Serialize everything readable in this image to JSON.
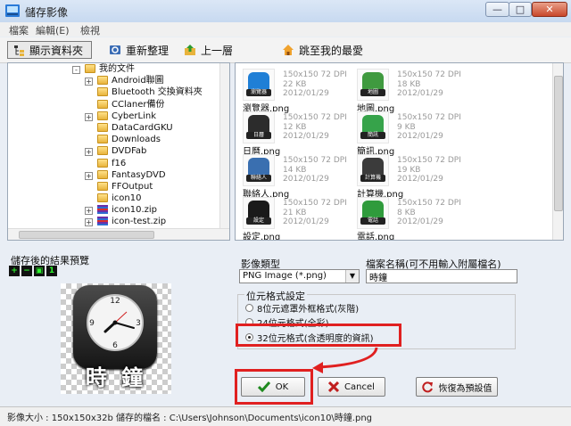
{
  "window": {
    "title": "儲存影像"
  },
  "menu": [
    "檔案",
    "編輯(E)",
    "檢視"
  ],
  "toolbar": {
    "show_folders": "顯示資料夾",
    "refresh": "重新整理",
    "up": "上一層",
    "favorites": "跳至我的最愛"
  },
  "tree": [
    {
      "label": "我的文件",
      "indent": 0,
      "expander": "-",
      "icon": "folder"
    },
    {
      "label": "Android聯圖",
      "indent": 1,
      "expander": "+",
      "icon": "folder"
    },
    {
      "label": "Bluetooth 交換資料夾",
      "indent": 1,
      "expander": "",
      "icon": "folder"
    },
    {
      "label": "CClaner備份",
      "indent": 1,
      "expander": "",
      "icon": "folder"
    },
    {
      "label": "CyberLink",
      "indent": 1,
      "expander": "+",
      "icon": "folder"
    },
    {
      "label": "DataCardGKU",
      "indent": 1,
      "expander": "",
      "icon": "folder"
    },
    {
      "label": "Downloads",
      "indent": 1,
      "expander": "",
      "icon": "folder"
    },
    {
      "label": "DVDFab",
      "indent": 1,
      "expander": "+",
      "icon": "folder"
    },
    {
      "label": "f16",
      "indent": 1,
      "expander": "",
      "icon": "folder"
    },
    {
      "label": "FantasyDVD",
      "indent": 1,
      "expander": "+",
      "icon": "folder"
    },
    {
      "label": "FFOutput",
      "indent": 1,
      "expander": "",
      "icon": "folder"
    },
    {
      "label": "icon10",
      "indent": 1,
      "expander": "",
      "icon": "folder"
    },
    {
      "label": "icon10.zip",
      "indent": 1,
      "expander": "+",
      "icon": "zip"
    },
    {
      "label": "icon-test.zip",
      "indent": 1,
      "expander": "+",
      "icon": "zip"
    }
  ],
  "files": [
    {
      "name": "瀏覽器.png",
      "dims": "150x150 72 DPI",
      "size": "22 KB",
      "date": "2012/01/29",
      "icon": "browser-icon",
      "color": "#1f7fd6",
      "caption": "瀏覽器"
    },
    {
      "name": "地圖.png",
      "dims": "150x150 72 DPI",
      "size": "18 KB",
      "date": "2012/01/29",
      "icon": "map-icon",
      "color": "#3f9a3f",
      "caption": "地圖"
    },
    {
      "name": "日曆.png",
      "dims": "150x150 72 DPI",
      "size": "12 KB",
      "date": "2012/01/29",
      "icon": "calendar-icon",
      "color": "#2c2c2c",
      "caption": "日曆"
    },
    {
      "name": "簡訊.png",
      "dims": "150x150 72 DPI",
      "size": "9 KB",
      "date": "2012/01/29",
      "icon": "message-icon",
      "color": "#36a34a",
      "caption": "簡訊"
    },
    {
      "name": "聯絡人.png",
      "dims": "150x150 72 DPI",
      "size": "14 KB",
      "date": "2012/01/29",
      "icon": "contacts-icon",
      "color": "#3a6fb0",
      "caption": "聯絡人"
    },
    {
      "name": "計算機.png",
      "dims": "150x150 72 DPI",
      "size": "19 KB",
      "date": "2012/01/29",
      "icon": "calculator-icon",
      "color": "#3b3b3b",
      "caption": "計算機"
    },
    {
      "name": "設定.png",
      "dims": "150x150 72 DPI",
      "size": "21 KB",
      "date": "2012/01/29",
      "icon": "settings-icon",
      "color": "#1a1a1a",
      "caption": "設定"
    },
    {
      "name": "電話.png",
      "dims": "150x150 72 DPI",
      "size": "8 KB",
      "date": "2012/01/29",
      "icon": "phone-icon",
      "color": "#2f9b3c",
      "caption": "電話"
    }
  ],
  "preview": {
    "title": "儲存後的結果預覽",
    "caption": "時 鐘",
    "zoom_buttons": [
      "zoom-in",
      "zoom-out",
      "fit",
      "1:1"
    ]
  },
  "format": {
    "type_label": "影像類型",
    "type_value": "PNG Image (*.png)",
    "filename_label": "檔案名稱(可不用輸入附屬檔名)",
    "filename_value": "時鐘",
    "bitdepth_legend": "位元格式設定",
    "options": [
      {
        "label": "8位元遮罩外框格式(灰階)",
        "selected": false
      },
      {
        "label": "24位元格式(全彩)",
        "selected": false
      },
      {
        "label": "32位元格式(含透明度的資訊)",
        "selected": true
      }
    ]
  },
  "buttons": {
    "ok": "OK",
    "cancel": "Cancel",
    "reset": "恢復為預設值"
  },
  "status": {
    "text": "影像大小 : 150x150x32b   儲存的檔名 : C:\\Users\\Johnson\\Documents\\icon10\\時鐘.png"
  }
}
